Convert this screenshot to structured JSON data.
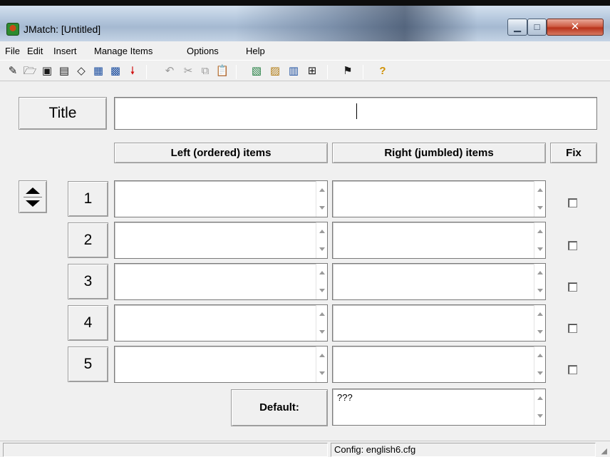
{
  "window": {
    "title": "JMatch: [Untitled]",
    "minimize": "▁",
    "maximize": "□",
    "close": "✕"
  },
  "menu": [
    "File",
    "Edit",
    "Insert",
    "Manage Items",
    "Options",
    "Help"
  ],
  "toolbar": {
    "icons": [
      "new-file-icon",
      "open-folder-icon",
      "save-icon",
      "save-as-icon",
      "eraser-icon",
      "create-web-page-icon",
      "create-drag-drop-page-icon",
      "add-down-icon",
      "undo-icon",
      "cut-icon",
      "copy-icon",
      "paste-icon",
      "web-icon",
      "folder-icon",
      "options-icon",
      "config-icon",
      "windows-icon",
      "help-icon"
    ]
  },
  "title_label": "Title",
  "title_value": "",
  "headers": {
    "left": "Left (ordered) items",
    "right": "Right (jumbled) items",
    "fix": "Fix"
  },
  "rows": [
    {
      "num": "1",
      "left": "",
      "right": "",
      "fix": false
    },
    {
      "num": "2",
      "left": "",
      "right": "",
      "fix": false
    },
    {
      "num": "3",
      "left": "",
      "right": "",
      "fix": false
    },
    {
      "num": "4",
      "left": "",
      "right": "",
      "fix": false
    },
    {
      "num": "5",
      "left": "",
      "right": "",
      "fix": false
    }
  ],
  "default_label": "Default:",
  "default_value": "???",
  "status": {
    "config": "Config: english6.cfg"
  },
  "colors": {
    "window_bg": "#f0f0f0",
    "close_button": "#c9452b",
    "arrow_red": "#d01010"
  }
}
